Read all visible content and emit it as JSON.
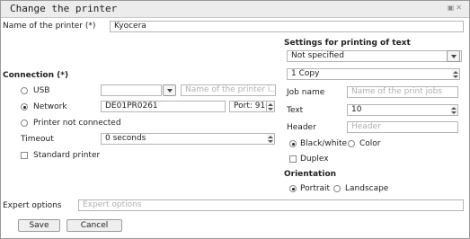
{
  "window": {
    "title": "Change the printer"
  },
  "printer_name": {
    "label": "Name of the printer (*)",
    "value": "Kyocera"
  },
  "connection": {
    "heading": "Connection (*)",
    "usb": {
      "label": "USB",
      "selected": false,
      "name_placeholder": "Name of the printer i..."
    },
    "network": {
      "label": "Network",
      "selected": true,
      "host": "DE01PR0261",
      "port_label": "Port:",
      "port": "9100"
    },
    "not_connected": {
      "label": "Printer  not connected",
      "selected": false
    },
    "timeout": {
      "label": "Timeout",
      "value": "0 seconds"
    },
    "standard_printer": {
      "label": "Standard printer",
      "checked": false
    }
  },
  "settings": {
    "heading": "Settings for printing of text",
    "paper": "Not specified",
    "copies": "1 Copy",
    "job_name": {
      "label": "Job name",
      "placeholder": "Name of the print jobs"
    },
    "text": {
      "label": "Text",
      "value": "10"
    },
    "header": {
      "label": "Header",
      "placeholder": "Header"
    },
    "color_mode": {
      "bw_label": "Black/white",
      "color_label": "Color",
      "selected": "Black/white"
    },
    "duplex": {
      "label": "Duplex",
      "checked": false
    },
    "orientation": {
      "heading": "Orientation",
      "portrait_label": "Portrait",
      "landscape_label": "Landscape",
      "selected": "Portrait"
    }
  },
  "expert": {
    "label": "Expert options",
    "placeholder": "Expert options"
  },
  "buttons": {
    "save": "Save",
    "cancel": "Cancel"
  }
}
